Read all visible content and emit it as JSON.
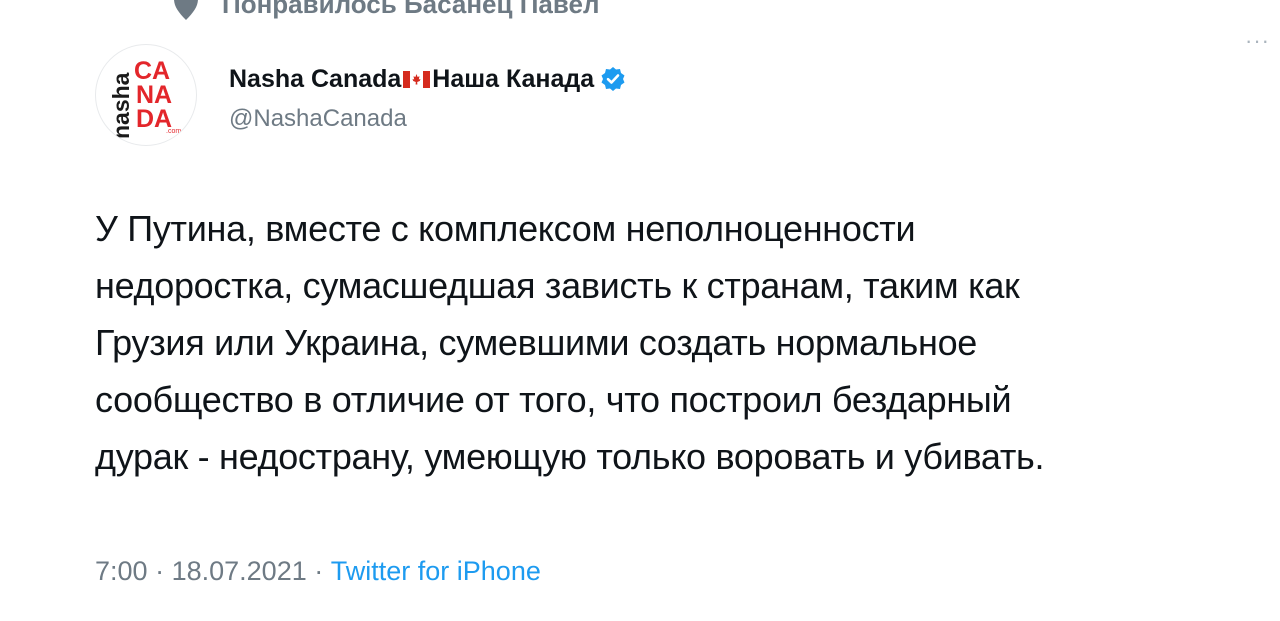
{
  "social_context": {
    "text": "Понравилось Басанец Павел",
    "icon": "heart-icon"
  },
  "author": {
    "display_name": "Nasha Canada",
    "display_name_ru": "Наша Канада",
    "handle": "@NashaCanada",
    "verified": true,
    "flag_icon": "canada-flag-icon",
    "avatar_logo_text": {
      "left": "nasha",
      "right_lines": [
        "CA",
        "NA",
        "DA"
      ],
      "small": ".com"
    }
  },
  "more_label": "···",
  "tweet": {
    "lines": [
      "У Путина, вместе с комплексом неполноценности",
      "недоростка, сумасшедшая зависть к странам, таким как",
      "Грузия или Украина, сумевшими создать нормальное",
      "сообщество в отличие от того, что построил бездарный",
      "дурак - недострану, умеющую только воровать и убивать."
    ]
  },
  "meta": {
    "time": "7:00",
    "separator": "·",
    "date": "18.07.2021",
    "source": "Twitter for iPhone"
  },
  "colors": {
    "accent": "#1d9bf0",
    "secondary_text": "#6e7a84",
    "logo_red": "#e3262b"
  }
}
